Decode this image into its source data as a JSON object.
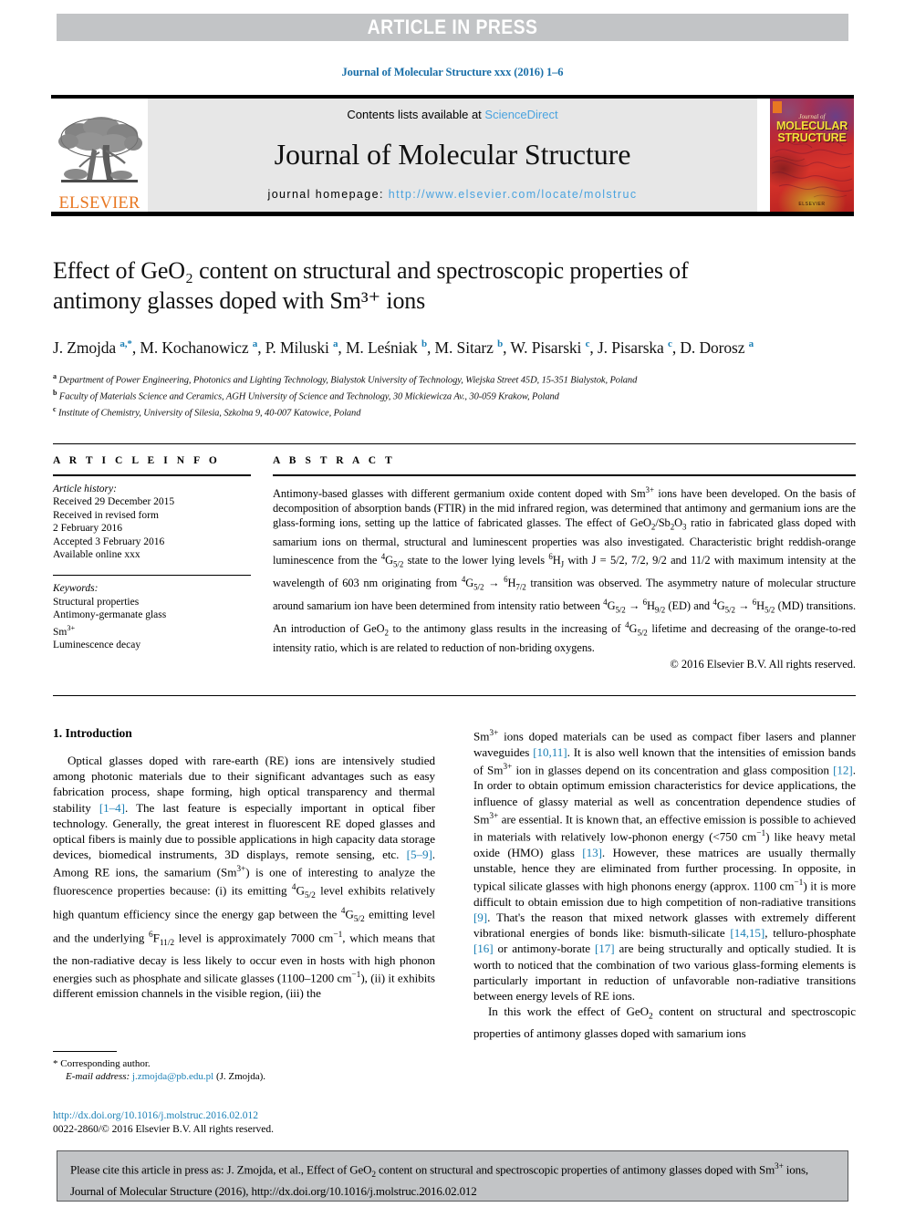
{
  "banner": {
    "label": "ARTICLE IN PRESS"
  },
  "running_head": {
    "text": "Journal of Molecular Structure xxx (2016) 1–6"
  },
  "masthead": {
    "contents_prefix": "Contents lists available at ",
    "sciencedirect": "ScienceDirect",
    "journal_title": "Journal of Molecular Structure",
    "homepage_prefix": "journal homepage: ",
    "homepage_url": "http://www.elsevier.com/locate/molstruc",
    "publisher": "ELSEVIER",
    "cover": {
      "journal_of": "Journal of",
      "line1": "MOLECULAR",
      "line2": "STRUCTURE",
      "footer": "ELSEVIER"
    }
  },
  "article": {
    "title_line1": "Effect of GeO₂ content on structural and spectroscopic properties of",
    "title_line2": "antimony glasses doped with Sm³⁺ ions",
    "authors_html": "J. Zmojda <sup class=\"aff-mark\">a,&#42;</sup>, M. Kochanowicz <sup class=\"aff-mark\">a</sup>, P. Miluski <sup class=\"aff-mark\">a</sup>, M. Leśniak <sup class=\"aff-mark\">b</sup>, M. Sitarz <sup class=\"aff-mark\">b</sup>, W. Pisarski <sup class=\"aff-mark\">c</sup>, J. Pisarska <sup class=\"aff-mark\">c</sup>, D. Dorosz <sup class=\"aff-mark\">a</sup>",
    "affiliations": [
      {
        "mark": "a",
        "text": "Department of Power Engineering, Photonics and Lighting Technology, Bialystok University of Technology, Wiejska Street 45D, 15-351 Bialystok, Poland"
      },
      {
        "mark": "b",
        "text": "Faculty of Materials Science and Ceramics, AGH University of Science and Technology, 30 Mickiewicza Av., 30-059 Krakow, Poland"
      },
      {
        "mark": "c",
        "text": "Institute of Chemistry, University of Silesia, Szkolna 9, 40-007 Katowice, Poland"
      }
    ]
  },
  "article_info": {
    "heading": "A R T I C L E  I N F O",
    "history_title": "Article history:",
    "history_lines": [
      "Received 29 December 2015",
      "Received in revised form",
      "2 February 2016",
      "Accepted 3 February 2016",
      "Available online xxx"
    ],
    "keywords_title": "Keywords:",
    "keywords": [
      "Structural properties",
      "Antimony-germanate glass",
      "Sm3+",
      "Luminescence decay"
    ]
  },
  "abstract": {
    "heading": "A B S T R A C T",
    "body_html": "Antimony-based glasses with different germanium oxide content doped with Sm<sup>3+</sup> ions have been developed. On the basis of decomposition of absorption bands (FTIR) in the mid infrared region, was determined that antimony and germanium ions are the glass-forming ions, setting up the lattice of fabricated glasses. The effect of GeO<sub>2</sub>/Sb<sub>2</sub>O<sub>3</sub> ratio in fabricated glass doped with samarium ions on thermal, structural and luminescent properties was also investigated. Characteristic bright reddish-orange luminescence from the <sup>4</sup>G<sub>5/2</sub> state to the lower lying levels <sup>6</sup>H<sub>J</sub> with J&nbsp;=&nbsp;5/2, 7/2, 9/2 and 11/2 with maximum intensity at the wavelength of 603&nbsp;nm originating from <sup>4</sup>G<sub>5/2</sub> &rarr; <sup>6</sup>H<sub>7/2</sub> transition was observed. The asymmetry nature of molecular structure around samarium ion have been determined from intensity ratio between <sup>4</sup>G<sub>5/2</sub> &rarr; <sup>6</sup>H<sub>9/2</sub> (ED) and <sup>4</sup>G<sub>5/2</sub> &rarr; <sup>6</sup>H<sub>5/2</sub> (MD) transitions. An introduction of GeO<sub>2</sub> to the antimony glass results in the increasing of <sup>4</sup>G<sub>5/2</sub> lifetime and decreasing of the orange-to-red intensity ratio, which is are related to reduction of non-briding oxygens.",
    "copyright": "© 2016 Elsevier B.V. All rights reserved."
  },
  "introduction": {
    "section_title": "1. Introduction",
    "left_paragraph_html": "Optical glasses doped with rare-earth (RE) ions are intensively studied among photonic materials due to their significant advantages such as easy fabrication process, shape forming, high optical transparency and thermal stability <span class=\"ref\">[1&ndash;4]</span>. The last feature is especially important in optical fiber technology. Generally, the great interest in fluorescent RE doped glasses and optical fibers is mainly due to possible applications in high capacity data storage devices, biomedical instruments, 3D displays, remote sensing, etc. <span class=\"ref\">[5&ndash;9]</span>. Among RE ions, the samarium (Sm<sup>3+</sup>) is one of interesting to analyze the fluorescence properties because: (i) its emitting <sup>4</sup>G<sub>5/2</sub> level exhibits relatively high quantum efficiency since the energy gap between the <sup>4</sup>G<sub>5/2</sub> emitting level and the underlying <sup>6</sup>F<sub>11/2</sub> level is approximately 7000&nbsp;cm<sup>&minus;1</sup>, which means that the non-radiative decay is less likely to occur even in hosts with high phonon energies such as phosphate and silicate glasses (1100&ndash;1200&nbsp;cm<sup>&minus;1</sup>), (ii) it exhibits different emission channels in the visible region, (iii) the",
    "right_paragraph_html": "Sm<sup>3+</sup> ions doped materials can be used as compact fiber lasers and planner waveguides <span class=\"ref\">[10,11]</span>. It is also well known that the intensities of emission bands of Sm<sup>3+</sup> ion in glasses depend on its concentration and glass composition <span class=\"ref\">[12]</span>. In order to obtain optimum emission characteristics for device applications, the influence of glassy material as well as concentration dependence studies of Sm<sup>3+</sup> are essential. It is known that, an effective emission is possible to achieved in materials with relatively low-phonon energy (&lt;750&nbsp;cm<sup>&minus;1</sup>) like heavy metal oxide (HMO) glass <span class=\"ref\">[13]</span>. However, these matrices are usually thermally unstable, hence they are eliminated from further processing. In opposite, in typical silicate glasses with high phonons energy (approx. 1100&nbsp;cm<sup>&minus;1</sup>) it is more difficult to obtain emission due to high competition of non-radiative transitions <span class=\"ref\">[9]</span>. That's the reason that mixed network glasses with extremely different vibrational energies of bonds like: bismuth-silicate <span class=\"ref\">[14,15]</span>, telluro-phosphate <span class=\"ref\">[16]</span> or antimony-borate <span class=\"ref\">[17]</span> are being structurally and optically studied. It is worth to noticed that the combination of two various glass-forming elements is particularly important in reduction of unfavorable non-radiative transitions between energy levels of RE ions.",
    "right_paragraph2_html": "In this work the effect of GeO<sub>2</sub> content on structural and spectroscopic properties of antimony glasses doped with samarium ions"
  },
  "footnote": {
    "corresponding": "* Corresponding author.",
    "email_label": "E-mail address:",
    "email": "j.zmojda@pb.edu.pl",
    "email_owner": "(J. Zmojda).",
    "doi_url": "http://dx.doi.org/10.1016/j.molstruc.2016.02.012",
    "issn_line": "0022-2860/© 2016 Elsevier B.V. All rights reserved."
  },
  "cite_box": {
    "text_html": "Please cite this article in press as: J. Zmojda, et al., Effect of GeO<sub>2</sub> content on structural and spectroscopic properties of antimony glasses doped with Sm<sup>3+</sup> ions, Journal of Molecular Structure (2016), http://dx.doi.org/10.1016/j.molstruc.2016.02.012"
  },
  "colors": {
    "banner_gray": "#c2c4c6",
    "link_blue": "#1a7fb5",
    "sciencedirect_blue": "#4aa3df",
    "elsevier_orange": "#e87722",
    "masthead_gray": "#e7e7e7"
  }
}
